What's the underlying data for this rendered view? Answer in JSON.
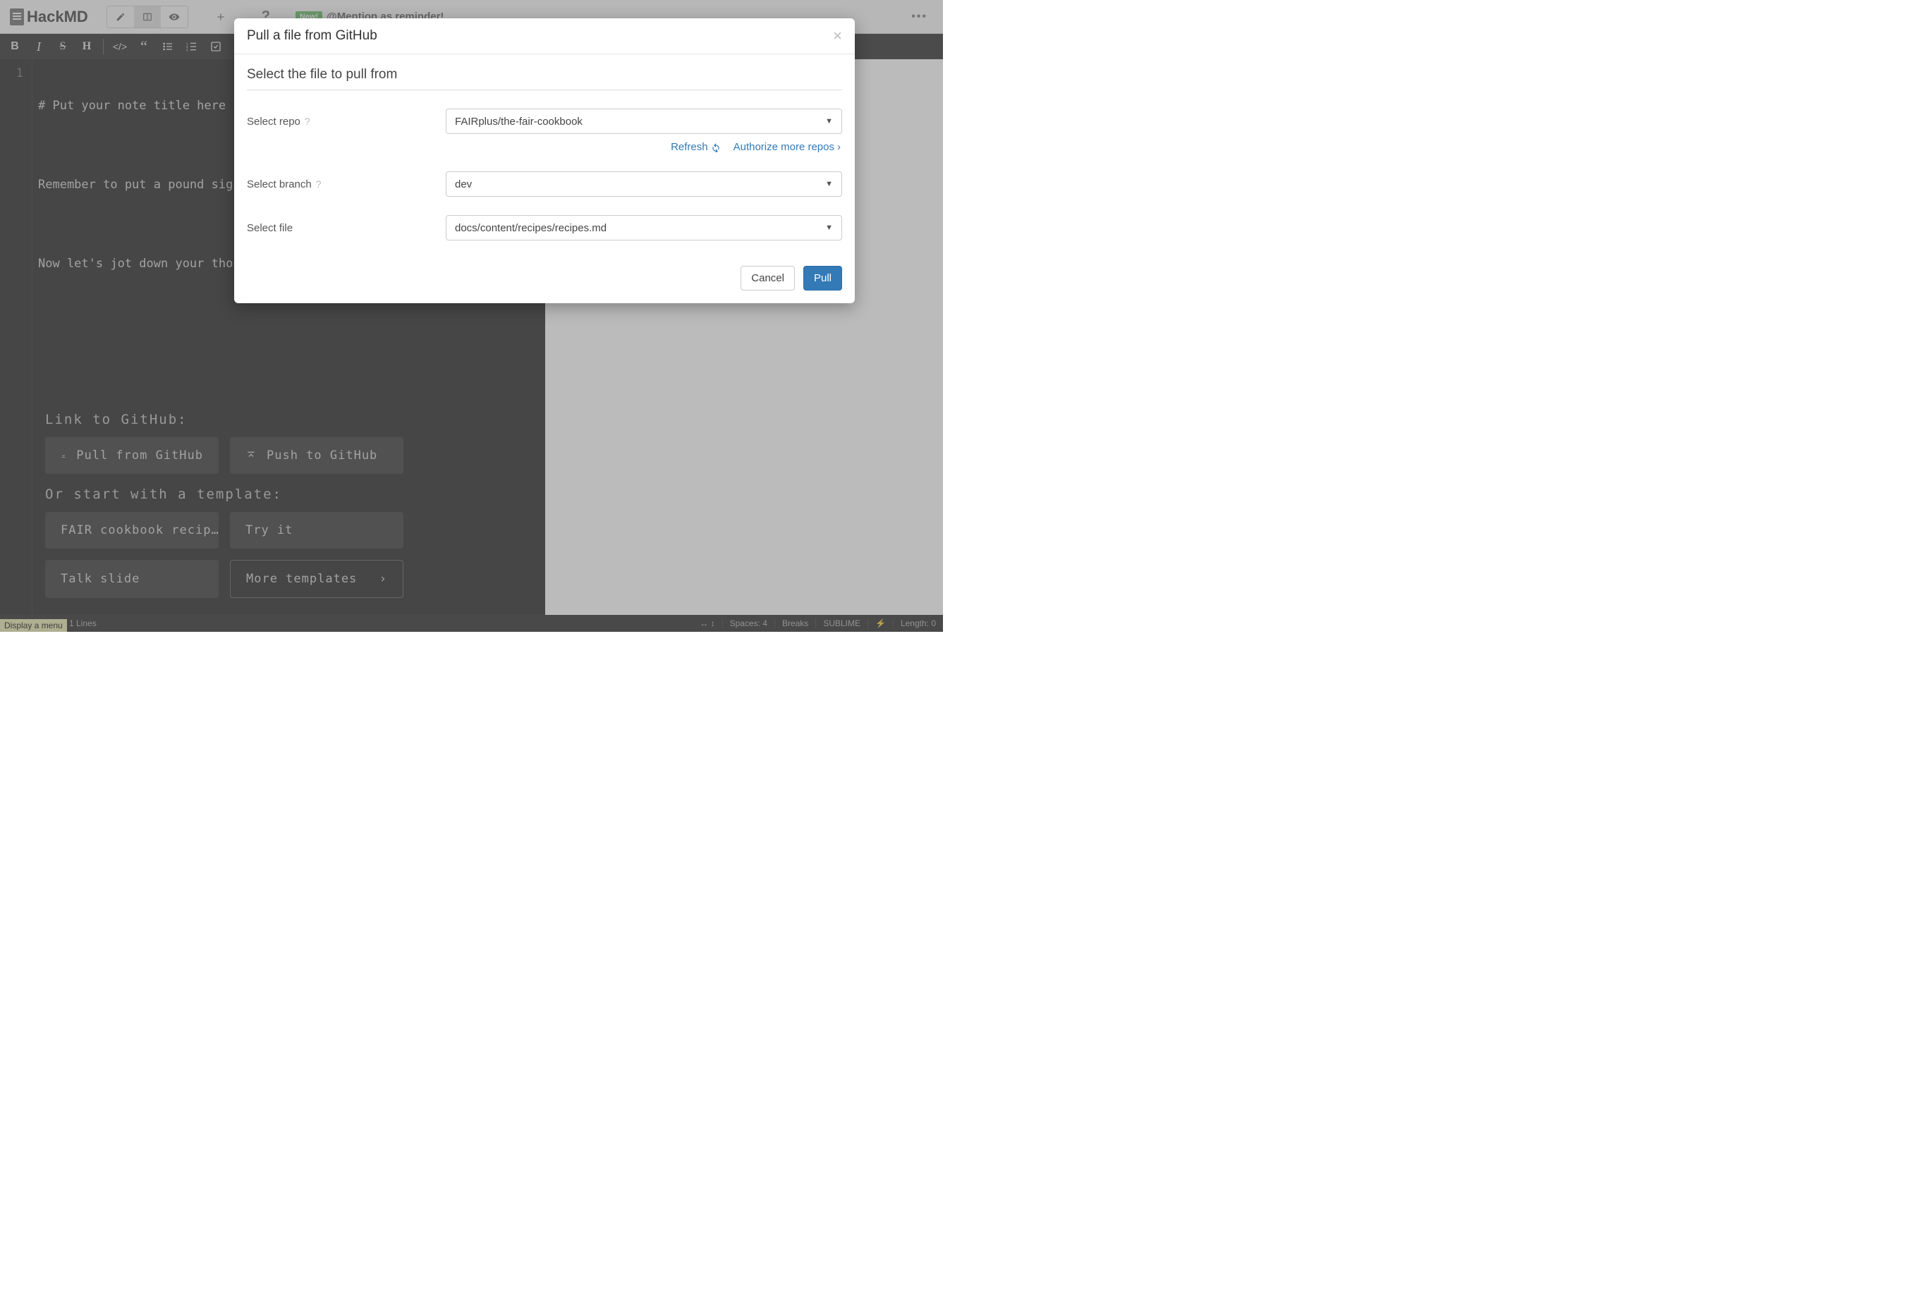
{
  "nav": {
    "brand": "HackMD",
    "new_badge": "New!",
    "mention": "@Mention as reminder!"
  },
  "editor": {
    "line_number": "1",
    "lines": [
      "# Put your note title here",
      "",
      "Remember to put a pound sign",
      "",
      "Now let's jot down your thoughts"
    ],
    "link_to_github_label": "Link to GitHub:",
    "pull_button": "Pull from GitHub",
    "push_button": "Push to GitHub",
    "template_label": "Or start with a template:",
    "templates": [
      "FAIR cookbook recip…",
      "Try it",
      "Talk slide"
    ],
    "more_templates": "More templates"
  },
  "status": {
    "display_menu": "Display a menu",
    "lines": "1 Lines",
    "spaces": "Spaces: 4",
    "breaks": "Breaks",
    "keymap": "SUBLIME",
    "length": "Length: 0"
  },
  "modal": {
    "title": "Pull a file from GitHub",
    "subtitle": "Select the file to pull from",
    "repo_label": "Select repo",
    "repo_value": "FAIRplus/the-fair-cookbook",
    "refresh": "Refresh",
    "authorize": "Authorize more repos",
    "branch_label": "Select branch",
    "branch_value": "dev",
    "file_label": "Select file",
    "file_value": "docs/content/recipes/recipes.md",
    "cancel": "Cancel",
    "pull": "Pull"
  }
}
